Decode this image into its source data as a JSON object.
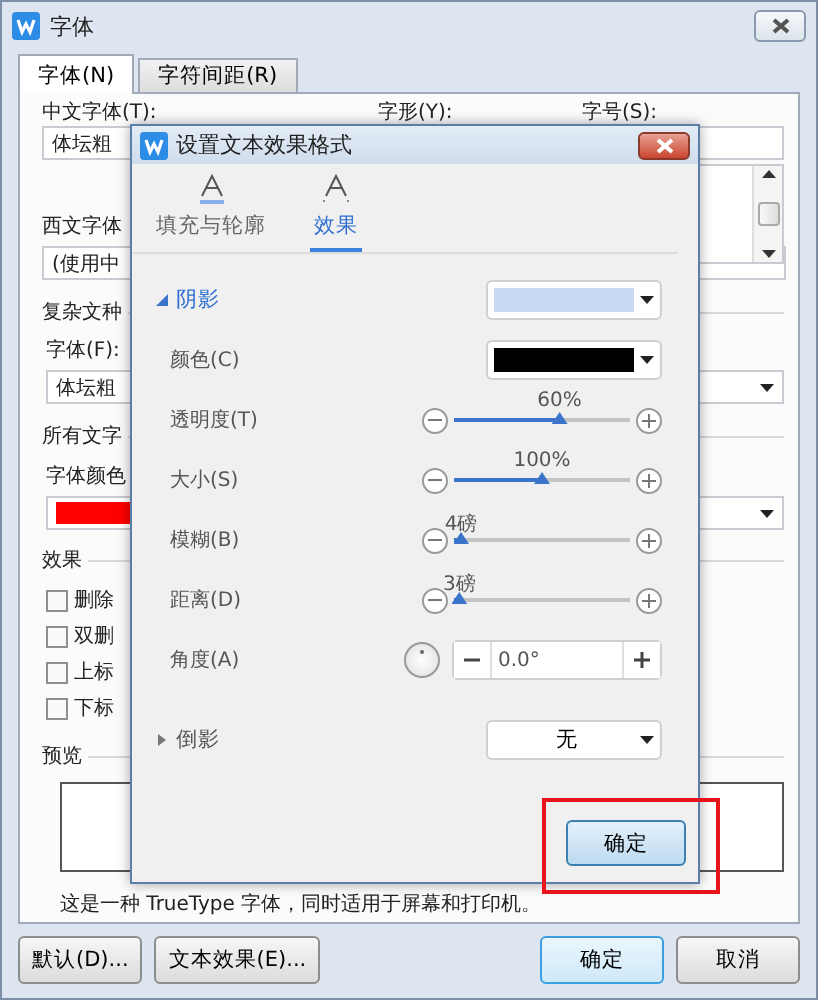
{
  "window": {
    "title": "字体"
  },
  "tabs": [
    {
      "label": "字体(N)",
      "selected": true
    },
    {
      "label": "字符间距(R)",
      "selected": false
    }
  ],
  "chinese_font": {
    "label": "中文字体(T):",
    "value": "体坛粗"
  },
  "style_label": "字形(Y):",
  "size_label": "字号(S):",
  "western_font": {
    "label": "西文字体",
    "value": "(使用中"
  },
  "complex_script": {
    "heading": "复杂文种",
    "label": "字体(F):",
    "value": "体坛粗"
  },
  "all_text": {
    "heading": "所有文字",
    "label": "字体颜色",
    "color": "#ff0000"
  },
  "effects": {
    "heading": "效果",
    "options": [
      {
        "label": "删除",
        "checked": false
      },
      {
        "label": "双删",
        "checked": false
      },
      {
        "label": "上标",
        "checked": false
      },
      {
        "label": "下标",
        "checked": false
      }
    ]
  },
  "preview": {
    "heading": "预览"
  },
  "description": "这是一种 TrueType 字体，同时适用于屏幕和打印机。",
  "left_buttons": [
    {
      "label": "默认(D)...",
      "default": false
    },
    {
      "label": "文本效果(E)...",
      "default": false
    }
  ],
  "right_buttons": [
    {
      "label": "确定",
      "default": true
    },
    {
      "label": "取消",
      "default": false
    }
  ],
  "effects_dialog": {
    "title": "设置文本效果格式",
    "tabs": [
      {
        "label": "填充与轮廓",
        "selected": false
      },
      {
        "label": "效果",
        "selected": true
      }
    ],
    "sections": [
      {
        "label": "阴影",
        "expanded": true,
        "color": "#c9daf5",
        "rows": [
          {
            "kind": "color",
            "label": "颜色(C)",
            "color": "#000000"
          },
          {
            "kind": "slider",
            "label": "透明度(T)",
            "value": "60%",
            "level": 0.6
          },
          {
            "kind": "slider",
            "label": "大小(S)",
            "value": "100%",
            "level": 0.5
          },
          {
            "kind": "slider",
            "label": "模糊(B)",
            "value": "4磅",
            "level": 0.04
          },
          {
            "kind": "slider",
            "label": "距离(D)",
            "value": "3磅",
            "level": 0.03
          },
          {
            "kind": "angle",
            "label": "角度(A)",
            "value": "0.0°"
          }
        ]
      },
      {
        "label": "倒影",
        "expanded": false,
        "value": "无"
      }
    ],
    "button": {
      "label": "确定",
      "highlighted": true
    }
  }
}
